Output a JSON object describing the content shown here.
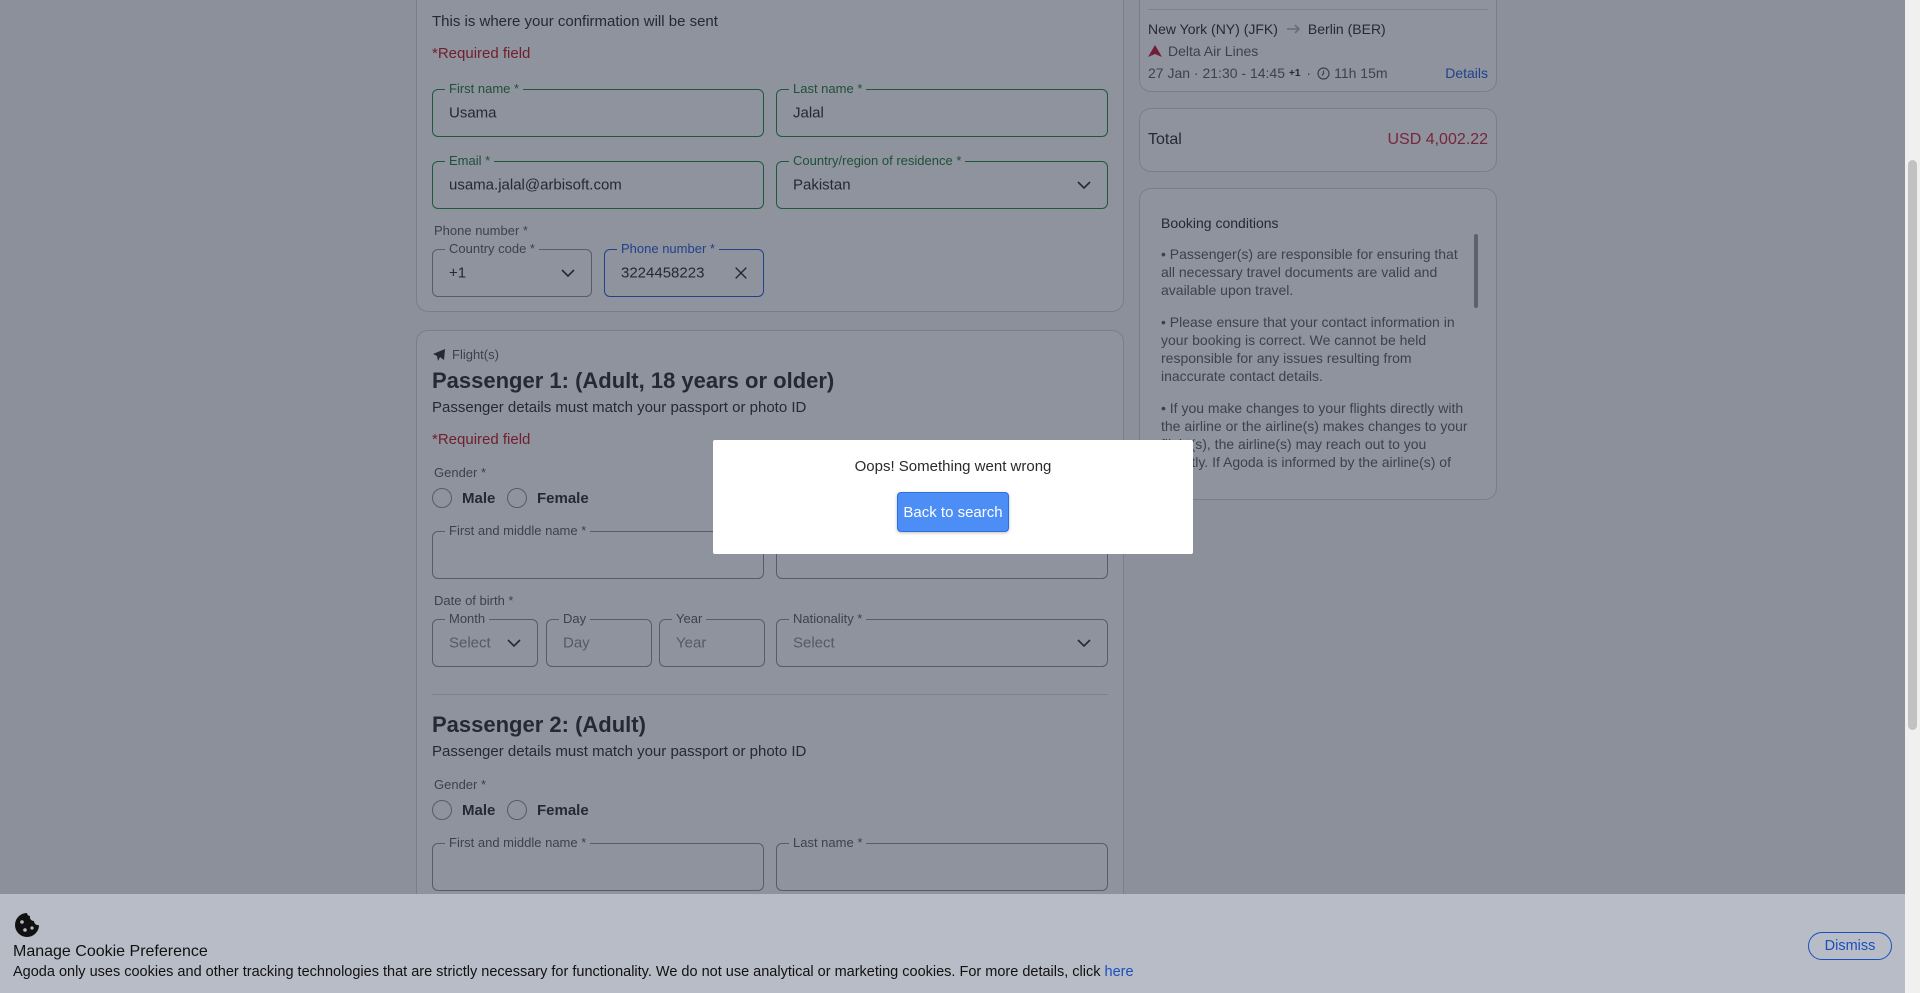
{
  "contact": {
    "note": "This is where your confirmation will be sent",
    "required": "*Required field",
    "first_name_label": "First name *",
    "first_name_value": "Usama",
    "last_name_label": "Last name *",
    "last_name_value": "Jalal",
    "email_label": "Email *",
    "email_value": "usama.jalal@arbisoft.com",
    "country_label": "Country/region of residence *",
    "country_value": "Pakistan",
    "phone_section": "Phone number *",
    "code_label": "Country code *",
    "code_value": "+1",
    "phone_label": "Phone number *",
    "phone_value": "3224458223"
  },
  "passenger1": {
    "flights_tag": "Flight(s)",
    "title": "Passenger 1: (Adult, 18 years or older)",
    "subtitle": "Passenger details must match your passport or photo ID",
    "required": "*Required field",
    "gender_label": "Gender *",
    "male": "Male",
    "female": "Female",
    "first_middle_label": "First and middle name *",
    "dob_label": "Date of birth *",
    "month_label": "Month",
    "month_value": "Select",
    "day_label": "Day",
    "day_placeholder": "Day",
    "year_label": "Year",
    "year_placeholder": "Year",
    "nationality_label": "Nationality *",
    "nationality_value": "Select"
  },
  "passenger2": {
    "title": "Passenger 2: (Adult)",
    "subtitle": "Passenger details must match your passport or photo ID",
    "gender_label": "Gender *",
    "male": "Male",
    "female": "Female",
    "first_middle_label": "First and middle name *",
    "last_name_label": "Last name *"
  },
  "flight_summary": {
    "route_from": "New York (NY) (JFK)",
    "route_to": "Berlin (BER)",
    "airline": "Delta Air Lines",
    "times": "27 Jan · 21:30 - 14:45",
    "day_offset": "+1",
    "duration": "11h 15m",
    "details_link": "Details"
  },
  "total": {
    "label": "Total",
    "value": "USD 4,002.22"
  },
  "conditions": {
    "title": "Booking conditions",
    "items": [
      "• Passenger(s) are responsible for ensuring that all necessary travel documents are valid and available upon travel.",
      "• Please ensure that your contact information in your booking is correct. We cannot be held responsible for any issues resulting from inaccurate contact details.",
      "• If you make changes to your flights directly with the airline or the airline(s) makes changes to your flight(s), the airline(s) may reach out to you directly. If Agoda is informed by the airline(s) of"
    ]
  },
  "modal": {
    "message": "Oops! Something went wrong",
    "button": "Back to search"
  },
  "cookie": {
    "title": "Manage Cookie Preference",
    "text": "Agoda only uses cookies and other tracking technologies that are strictly necessary for functionality. We do not use analytical or marketing cookies. For more details, click ",
    "link": "here",
    "dismiss": "Dismiss"
  },
  "colors": {
    "valid_border": "#208a3c",
    "focus_border": "#2858d8",
    "error_text": "#c4161c",
    "price": "#d0243a",
    "primary_button": "#4c8df6"
  }
}
